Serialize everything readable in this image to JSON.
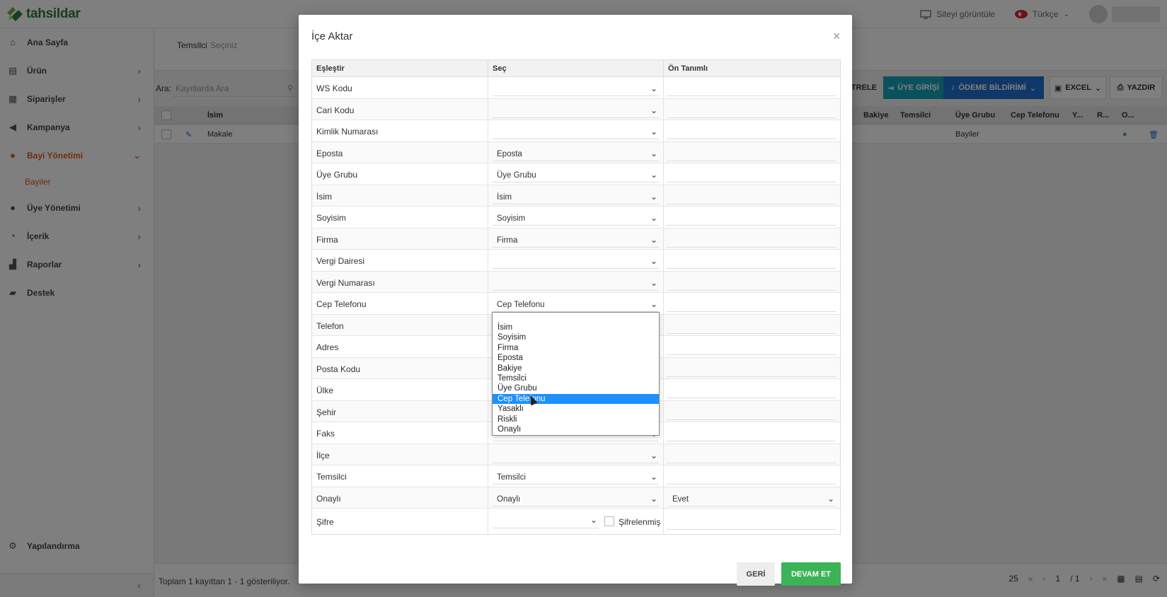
{
  "brand": {
    "name": "tahsildar"
  },
  "topbar": {
    "view_site": "Siteyi görüntüle",
    "language": "Türkçe"
  },
  "sidebar": {
    "items": [
      {
        "label": "Ana Sayfa",
        "icon": "home-icon"
      },
      {
        "label": "Ürün",
        "icon": "basket-icon"
      },
      {
        "label": "Siparişler",
        "icon": "store-icon"
      },
      {
        "label": "Kampanya",
        "icon": "megaphone-icon"
      },
      {
        "label": "Bayi Yönetimi",
        "icon": "users-icon"
      },
      {
        "label": "Üye Yönetimi",
        "icon": "user-icon"
      },
      {
        "label": "İçerik",
        "icon": "feed-icon"
      },
      {
        "label": "Raporlar",
        "icon": "chart-icon"
      },
      {
        "label": "Destek",
        "icon": "support-icon"
      }
    ],
    "sub_item": "Bayiler",
    "config": "Yapılandırma"
  },
  "filter": {
    "label": "Temsilci",
    "placeholder": "Seçiniz"
  },
  "toolbar": {
    "search_label": "Ara:",
    "search_placeholder": "Kayıtlarda Ara",
    "filter_btn": "LTRELE",
    "member_login_btn": "ÜYE GİRİŞİ",
    "payment_btn": "ÖDEME BİLDİRİMİ",
    "excel_btn": "EXCEL",
    "print_btn": "YAZDIR"
  },
  "grid": {
    "headers": [
      "İsim",
      "Bakiye",
      "Temsilci",
      "Üye Grubu",
      "Cep Telefonu",
      "Y...",
      "R...",
      "O..."
    ],
    "row": {
      "name": "Makale",
      "group": "Bayiler"
    }
  },
  "footer": {
    "summary": "Toplam 1 kayıttan 1 - 1 gösteriliyor.",
    "page_size": "25",
    "page": "1",
    "total_pages": "/ 1"
  },
  "modal": {
    "title": "İçe Aktar",
    "headers": [
      "Eşleştir",
      "Seç",
      "Ön Tanımlı"
    ],
    "rows": [
      {
        "field": "WS Kodu",
        "select": "",
        "default": ""
      },
      {
        "field": "Cari Kodu",
        "select": "",
        "default": ""
      },
      {
        "field": "Kimlik Numarası",
        "select": "",
        "default": ""
      },
      {
        "field": "Eposta",
        "select": "Eposta",
        "default": ""
      },
      {
        "field": "Üye Grubu",
        "select": "Üye Grubu",
        "default": ""
      },
      {
        "field": "İsim",
        "select": "İsim",
        "default": ""
      },
      {
        "field": "Soyisim",
        "select": "Soyisim",
        "default": ""
      },
      {
        "field": "Firma",
        "select": "Firma",
        "default": ""
      },
      {
        "field": "Vergi Dairesi",
        "select": "",
        "default": ""
      },
      {
        "field": "Vergi Numarası",
        "select": "",
        "default": ""
      },
      {
        "field": "Cep Telefonu",
        "select": "Cep Telefonu",
        "default": ""
      },
      {
        "field": "Telefon",
        "select": "",
        "default": ""
      },
      {
        "field": "Adres",
        "select": "",
        "default": ""
      },
      {
        "field": "Posta Kodu",
        "select": "",
        "default": ""
      },
      {
        "field": "Ülke",
        "select": "",
        "default": ""
      },
      {
        "field": "Şehir",
        "select": "",
        "default": ""
      },
      {
        "field": "Faks",
        "select": "",
        "default": ""
      },
      {
        "field": "İlçe",
        "select": "",
        "default": ""
      },
      {
        "field": "Temsilci",
        "select": "Temsilci",
        "default": ""
      },
      {
        "field": "Onaylı",
        "select": "Onaylı",
        "default": "Evet"
      }
    ],
    "password_row": {
      "field": "Şifre",
      "encrypted_label": "Şifrelenmiş"
    },
    "dropdown_options": [
      "İsim",
      "Soyisim",
      "Firma",
      "Eposta",
      "Bakiye",
      "Temsilci",
      "Üye Grubu",
      "Cep Telefonu",
      "Yasaklı",
      "Riskli",
      "Onaylı"
    ],
    "dropdown_selected": "Cep Telefonu",
    "back_btn": "GERİ",
    "next_btn": "DEVAM ET"
  }
}
